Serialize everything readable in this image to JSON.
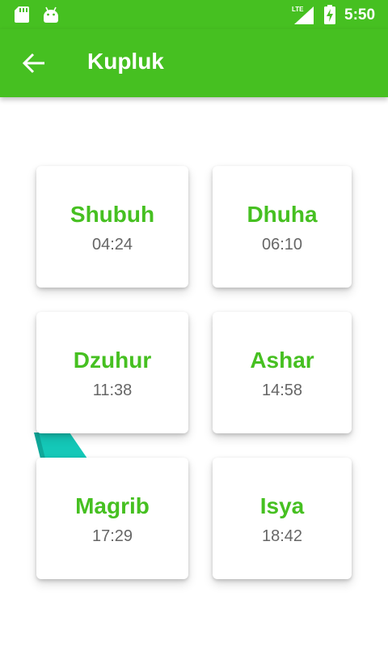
{
  "status_bar": {
    "time": "5:50",
    "network": "LTE",
    "icons": [
      "sd-card-icon",
      "android-icon",
      "lte-signal-icon",
      "battery-charging-icon"
    ]
  },
  "app_bar": {
    "title": "Kupluk",
    "back_icon": "arrow-left-icon"
  },
  "colors": {
    "primary": "#46c021",
    "accent_teal": "#14c8b8",
    "time_text": "#666666"
  },
  "prayers": [
    {
      "name": "Shubuh",
      "time": "04:24"
    },
    {
      "name": "Dhuha",
      "time": "06:10"
    },
    {
      "name": "Dzuhur",
      "time": "11:38"
    },
    {
      "name": "Ashar",
      "time": "14:58"
    },
    {
      "name": "Magrib",
      "time": "17:29"
    },
    {
      "name": "Isya",
      "time": "18:42"
    }
  ]
}
